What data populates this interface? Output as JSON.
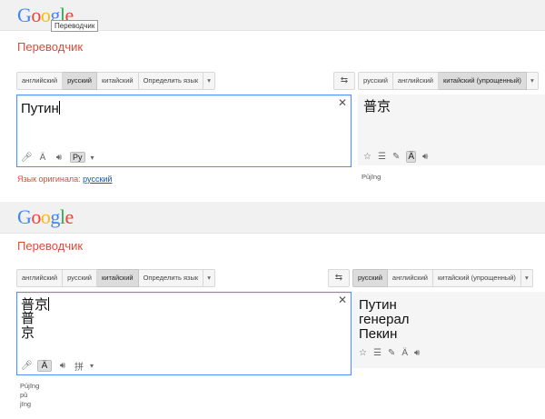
{
  "panel1": {
    "logo": "Google",
    "tooltip": "Переводчик",
    "title": "Переводчик",
    "source_langs": [
      "английский",
      "русский",
      "китайский",
      "Определить язык"
    ],
    "source_selected": 1,
    "target_langs": [
      "русский",
      "английский",
      "китайский (упрощенный)"
    ],
    "target_selected": 2,
    "source_text": "Путин",
    "target_text": "普京",
    "source_tools": {
      "mic": "mic-icon",
      "accent": "Ä",
      "speaker": "speaker-icon",
      "keyboard": "Ру"
    },
    "target_romanization": "Pǔjīng",
    "detect_label": "Язык оригинала:",
    "detect_lang": "русский"
  },
  "panel2": {
    "logo": "Google",
    "title": "Переводчик",
    "source_langs": [
      "английский",
      "русский",
      "китайский",
      "Определить язык"
    ],
    "source_selected": 2,
    "target_langs": [
      "русский",
      "английский",
      "китайский (упрощенный)"
    ],
    "target_selected": 0,
    "source_lines": [
      "普京",
      "普",
      "京"
    ],
    "target_lines": [
      "Путин",
      "генерал",
      "Пекин"
    ],
    "source_tools": {
      "accent": "Ä",
      "keyboard": "拼"
    },
    "source_romanization": [
      "Pǔjīng",
      "pǔ",
      "jīng"
    ]
  },
  "colors": {
    "accent": "#4d90fe",
    "title": "#dd4b39",
    "link": "#1155cc"
  },
  "icons": [
    "swap-icon",
    "clear-icon",
    "mic-icon",
    "speaker-icon",
    "star-icon",
    "list-icon",
    "pencil-icon",
    "dropdown-icon"
  ]
}
